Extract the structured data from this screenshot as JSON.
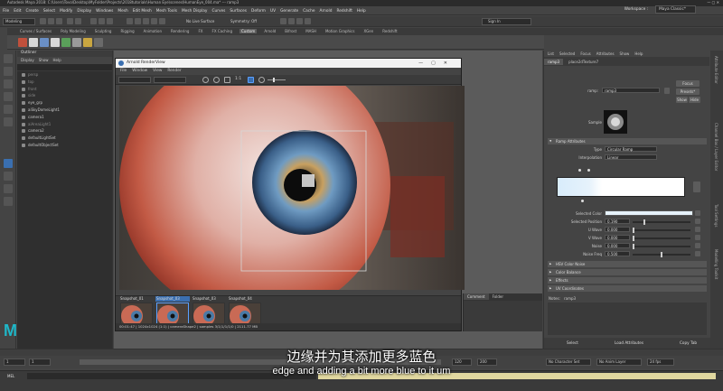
{
  "window": {
    "title": "Autodesk Maya 2018: C:\\Users\\Tovo\\Desktop\\MyFolder\\Projects\\2018tutorials\\Human Eye\\scenes\\HumanEye_004.ma* --- ramp3"
  },
  "menubar": {
    "items": [
      "File",
      "Edit",
      "Create",
      "Select",
      "Modify",
      "Display",
      "Windows",
      "Mesh",
      "Edit Mesh",
      "Mesh Tools",
      "Mesh Display",
      "Curves",
      "Surfaces",
      "Deform",
      "UV",
      "Generate",
      "Cache",
      "Arnold",
      "Redshift",
      "Help"
    ],
    "workspace_label": "Workspace :",
    "workspace_value": "Maya Classic*"
  },
  "statusline": {
    "mode": "Modeling",
    "live_surface": "No Live Surface",
    "symmetry": "Symmetry: Off",
    "sign_in": "Sign In"
  },
  "shelf": {
    "tabs": [
      "Curves / Surfaces",
      "Poly Modeling",
      "Sculpting",
      "Rigging",
      "Animation",
      "Rendering",
      "FX",
      "FX Caching",
      "Custom",
      "Arnold",
      "Bifrost",
      "MASH",
      "Motion Graphics",
      "XGen",
      "Redshift"
    ],
    "active_tab": "Custom"
  },
  "outliner": {
    "title": "Outliner",
    "menu": [
      "Display",
      "Show",
      "Help"
    ],
    "items": [
      {
        "label": "persp",
        "dim": true
      },
      {
        "label": "top",
        "dim": true
      },
      {
        "label": "front",
        "dim": true
      },
      {
        "label": "side",
        "dim": true
      },
      {
        "label": "eye_grp",
        "dim": false
      },
      {
        "label": "aiSkyDomeLight1",
        "dim": false
      },
      {
        "label": "camera1",
        "dim": false
      },
      {
        "label": "aiAreaLight1",
        "dim": true
      },
      {
        "label": "camera2",
        "dim": false
      },
      {
        "label": "defaultLightSet",
        "dim": false
      },
      {
        "label": "defaultObjectSet",
        "dim": false
      }
    ]
  },
  "renderview": {
    "title": "Arnold RenderView",
    "menu": [
      "File",
      "Window",
      "View",
      "Render"
    ],
    "ratio": "1:1",
    "snapshots": [
      {
        "label": "Snapshot_01",
        "selected": false
      },
      {
        "label": "Snapshot_03",
        "selected": true
      },
      {
        "label": "Snapshot_03",
        "selected": false
      },
      {
        "label": "Snapshot_04",
        "selected": false
      }
    ],
    "status": "00:01:47 | 1024x1024 (1:1) | cameraShape2 | samples 3/1/1/1/1/0 | 2111.77 MB",
    "comment_tabs": [
      "Comment",
      "Folder"
    ]
  },
  "attribute_editor": {
    "menu": [
      "List",
      "Selected",
      "Focus",
      "Attributes",
      "Show",
      "Help"
    ],
    "tabs": [
      "ramp3",
      "place2dTexture7"
    ],
    "node_label": "ramp:",
    "node_value": "ramp3",
    "focus": "Focus",
    "presets": "Presets*",
    "show": "Show",
    "hide": "Hide",
    "sample_label": "Sample",
    "section_ramp": "Ramp Attributes",
    "type_label": "Type",
    "type_value": "Circular Ramp",
    "interp_label": "Interpolation",
    "interp_value": "Linear",
    "rows": [
      {
        "label": "Selected Color",
        "value": ""
      },
      {
        "label": "Selected Position",
        "value": "0.190"
      },
      {
        "label": "U Wave",
        "value": "0.000"
      },
      {
        "label": "V Wave",
        "value": "0.000"
      },
      {
        "label": "Noise",
        "value": "0.000"
      },
      {
        "label": "Noise Freq",
        "value": "0.500"
      }
    ],
    "sections": [
      "HSV Color Noise",
      "Color Balance",
      "Effects",
      "UV Coordinates"
    ],
    "notes_label": "Notes:",
    "notes_value": "ramp3",
    "bottom_buttons": [
      "Select",
      "Load Attributes",
      "Copy Tab"
    ]
  },
  "sidetabs": [
    "Attribute Editor",
    "Channel Box / Layer Editor",
    "Tool Settings",
    "Modelling Toolkit"
  ],
  "range": {
    "start": "1",
    "end_a": "120",
    "end_b": "200",
    "character": "No Character Set",
    "anim_layer": "No Anim Layer",
    "fps": "24 fps"
  },
  "cmdline": {
    "mel": "MEL"
  },
  "subtitles": {
    "cn": "边缘并为其添加更多蓝色",
    "en": "edge and adding a bit more blue to it um"
  },
  "colors": {
    "accent": "#3b6fb0",
    "ramp_color": "#e6f2fb",
    "maya_logo": "#1fb7c8"
  }
}
